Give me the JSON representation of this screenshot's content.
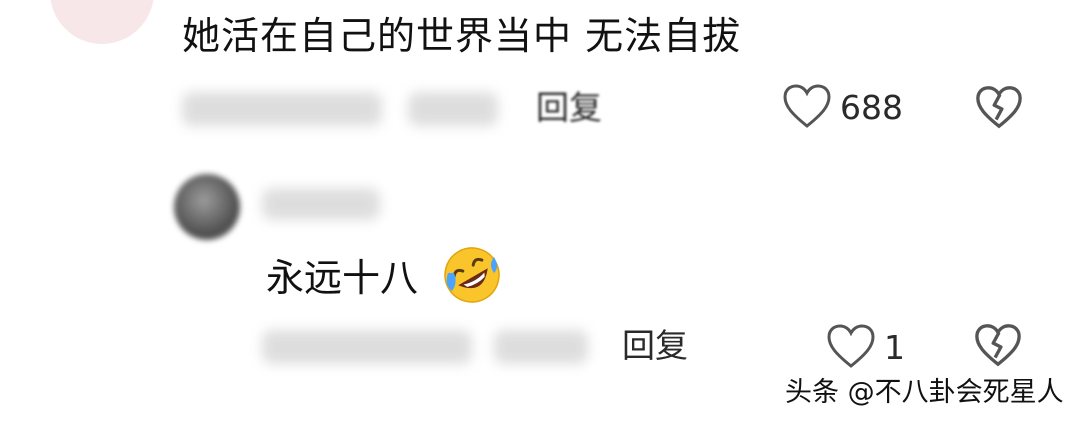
{
  "comment": {
    "text": "她活在自己的世界当中 无法自拔",
    "reply_label": "回复",
    "like_count": "688"
  },
  "nested_reply": {
    "text": "永远十八",
    "emoji": "rolling-on-floor-laughing-emoji",
    "reply_label": "回复",
    "like_count": "1"
  },
  "watermark": "头条 @不八卦会死星人",
  "colors": {
    "text": "#111111",
    "icon_stroke": "#555555",
    "blur_placeholder": "#dcdcdc"
  }
}
